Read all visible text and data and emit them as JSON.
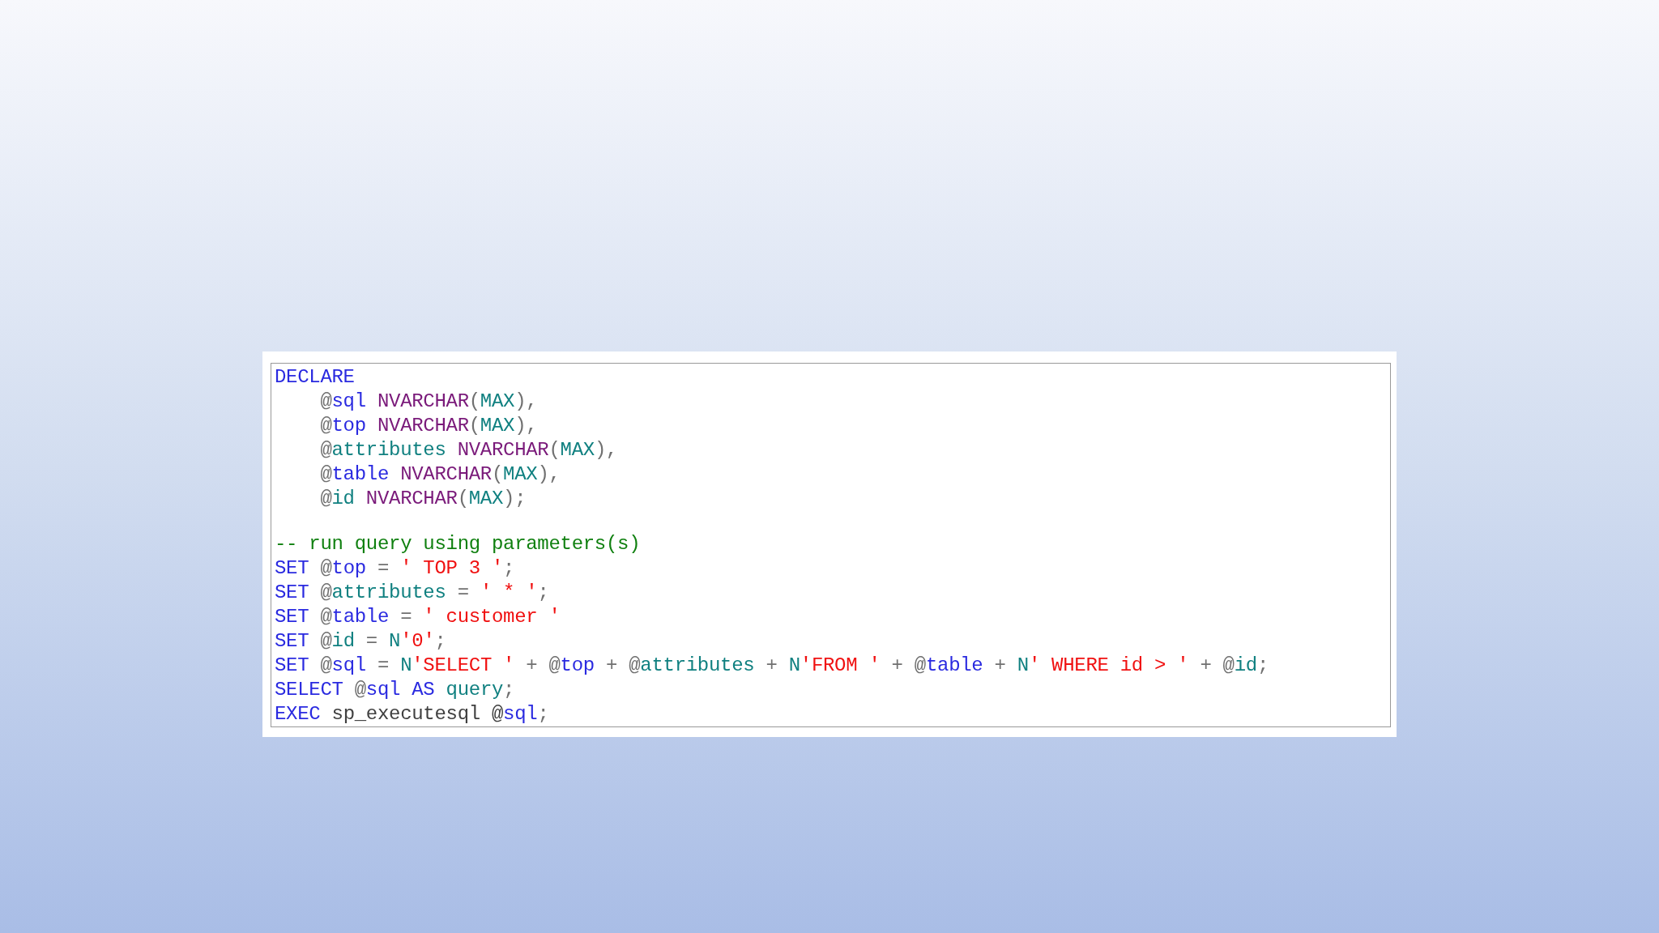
{
  "code_block": {
    "lines": [
      {
        "kind": "code",
        "tokens": [
          {
            "text": "DECLARE",
            "kind": "keyword"
          }
        ]
      },
      {
        "kind": "code",
        "tokens": [
          {
            "text": "    @",
            "kind": "punct"
          },
          {
            "text": "sql",
            "kind": "variable"
          },
          {
            "text": " NVARCHAR",
            "kind": "type"
          },
          {
            "text": "(",
            "kind": "punct"
          },
          {
            "text": "MAX",
            "kind": "ident"
          },
          {
            "text": "),",
            "kind": "punct"
          }
        ]
      },
      {
        "kind": "code",
        "tokens": [
          {
            "text": "    @",
            "kind": "punct"
          },
          {
            "text": "top",
            "kind": "variable"
          },
          {
            "text": " NVARCHAR",
            "kind": "type"
          },
          {
            "text": "(",
            "kind": "punct"
          },
          {
            "text": "MAX",
            "kind": "ident"
          },
          {
            "text": "),",
            "kind": "punct"
          }
        ]
      },
      {
        "kind": "code",
        "tokens": [
          {
            "text": "    @",
            "kind": "punct"
          },
          {
            "text": "attributes",
            "kind": "ident"
          },
          {
            "text": " NVARCHAR",
            "kind": "type"
          },
          {
            "text": "(",
            "kind": "punct"
          },
          {
            "text": "MAX",
            "kind": "ident"
          },
          {
            "text": "),",
            "kind": "punct"
          }
        ]
      },
      {
        "kind": "code",
        "tokens": [
          {
            "text": "    @",
            "kind": "punct"
          },
          {
            "text": "table",
            "kind": "variable"
          },
          {
            "text": " NVARCHAR",
            "kind": "type"
          },
          {
            "text": "(",
            "kind": "punct"
          },
          {
            "text": "MAX",
            "kind": "ident"
          },
          {
            "text": "),",
            "kind": "punct"
          }
        ]
      },
      {
        "kind": "code",
        "tokens": [
          {
            "text": "    @",
            "kind": "punct"
          },
          {
            "text": "id",
            "kind": "ident"
          },
          {
            "text": " NVARCHAR",
            "kind": "type"
          },
          {
            "text": "(",
            "kind": "punct"
          },
          {
            "text": "MAX",
            "kind": "ident"
          },
          {
            "text": ");",
            "kind": "punct"
          }
        ]
      },
      {
        "kind": "blank"
      },
      {
        "kind": "code",
        "tokens": [
          {
            "text": "-- run query using parameters(s)",
            "kind": "comment"
          }
        ]
      },
      {
        "kind": "code",
        "tokens": [
          {
            "text": "SET",
            "kind": "keyword"
          },
          {
            "text": " @",
            "kind": "punct"
          },
          {
            "text": "top",
            "kind": "variable"
          },
          {
            "text": " = ",
            "kind": "punct"
          },
          {
            "text": "' TOP 3 '",
            "kind": "string"
          },
          {
            "text": ";",
            "kind": "punct"
          }
        ]
      },
      {
        "kind": "code",
        "tokens": [
          {
            "text": "SET",
            "kind": "keyword"
          },
          {
            "text": " @",
            "kind": "punct"
          },
          {
            "text": "attributes",
            "kind": "ident"
          },
          {
            "text": " = ",
            "kind": "punct"
          },
          {
            "text": "' * '",
            "kind": "string"
          },
          {
            "text": ";",
            "kind": "punct"
          }
        ]
      },
      {
        "kind": "code",
        "tokens": [
          {
            "text": "SET",
            "kind": "keyword"
          },
          {
            "text": " @",
            "kind": "punct"
          },
          {
            "text": "table",
            "kind": "variable"
          },
          {
            "text": " = ",
            "kind": "punct"
          },
          {
            "text": "' customer '",
            "kind": "string"
          }
        ]
      },
      {
        "kind": "code",
        "tokens": [
          {
            "text": "SET",
            "kind": "keyword"
          },
          {
            "text": " @",
            "kind": "punct"
          },
          {
            "text": "id",
            "kind": "ident"
          },
          {
            "text": " = ",
            "kind": "punct"
          },
          {
            "text": "N",
            "kind": "ident"
          },
          {
            "text": "'0'",
            "kind": "string"
          },
          {
            "text": ";",
            "kind": "punct"
          }
        ]
      },
      {
        "kind": "code",
        "tokens": [
          {
            "text": "SET",
            "kind": "keyword"
          },
          {
            "text": " @",
            "kind": "punct"
          },
          {
            "text": "sql",
            "kind": "variable"
          },
          {
            "text": " = ",
            "kind": "punct"
          },
          {
            "text": "N",
            "kind": "ident"
          },
          {
            "text": "'SELECT '",
            "kind": "string"
          },
          {
            "text": " + @",
            "kind": "punct"
          },
          {
            "text": "top",
            "kind": "variable"
          },
          {
            "text": " + @",
            "kind": "punct"
          },
          {
            "text": "attributes",
            "kind": "ident"
          },
          {
            "text": " + ",
            "kind": "punct"
          },
          {
            "text": "N",
            "kind": "ident"
          },
          {
            "text": "'FROM '",
            "kind": "string"
          },
          {
            "text": " + @",
            "kind": "punct"
          },
          {
            "text": "table",
            "kind": "variable"
          },
          {
            "text": " + ",
            "kind": "punct"
          },
          {
            "text": "N",
            "kind": "ident"
          },
          {
            "text": "' WHERE id > '",
            "kind": "string"
          },
          {
            "text": " + @",
            "kind": "punct"
          },
          {
            "text": "id",
            "kind": "ident"
          },
          {
            "text": ";",
            "kind": "punct"
          }
        ]
      },
      {
        "kind": "code",
        "tokens": [
          {
            "text": "SELECT",
            "kind": "keyword"
          },
          {
            "text": " @",
            "kind": "punct"
          },
          {
            "text": "sql",
            "kind": "variable"
          },
          {
            "text": " AS",
            "kind": "keyword"
          },
          {
            "text": " query",
            "kind": "ident"
          },
          {
            "text": ";",
            "kind": "punct"
          }
        ]
      },
      {
        "kind": "code",
        "tokens": [
          {
            "text": "EXEC",
            "kind": "keyword"
          },
          {
            "text": " sp_executesql @",
            "kind": "plain"
          },
          {
            "text": "sql",
            "kind": "variable"
          },
          {
            "text": ";",
            "kind": "punct"
          }
        ]
      }
    ]
  }
}
